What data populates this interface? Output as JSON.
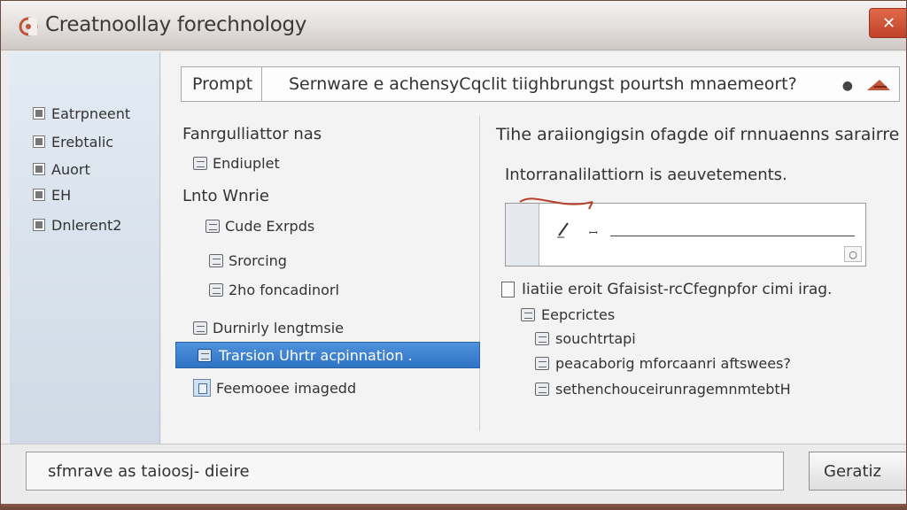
{
  "window": {
    "title": "Creatnoollay forechnology"
  },
  "sidebar": {
    "items": [
      {
        "label": "Eatrpneent"
      },
      {
        "label": "Erebtalic"
      },
      {
        "label": "Auort"
      },
      {
        "label": "EH"
      },
      {
        "label": "Dnlerent2"
      }
    ]
  },
  "prompt": {
    "label": "Prompt",
    "value": "Sernware e achensyCqclit tiighbrungst pourtsh mnaemeort?"
  },
  "left_column": {
    "heading": "Fanrgulliattor nas",
    "input_label": "Endiuplet",
    "section_heading": "Lnto Wnrie",
    "items": [
      {
        "label": "Cude Exrpds"
      },
      {
        "label": "Srorcing"
      },
      {
        "label": "2ho foncadinorl"
      },
      {
        "label": "Durnirly lengtmsie"
      }
    ],
    "selected_item": "Trarsion Uhrtr acpinnation .",
    "last_item": "Feemooee imagedd"
  },
  "right_column": {
    "title": "Tihe araiiongigsin ofagde oif rnnuaenns sarairre",
    "subtitle": "Intorranalilattiorn is aeuvetements.",
    "option_label": "Iiatiie eroit Gfaisist-rcCfegnpfor cimi irag.",
    "sub_items": [
      {
        "label": "Eepcrictes"
      },
      {
        "label": "souchtrtapi"
      },
      {
        "label": "peacaborig mforcaanri aftswees?"
      },
      {
        "label": "sethenchouceirunragemnmtebtH"
      }
    ]
  },
  "footer": {
    "status": "sfmrave as taioosj- dieire",
    "generate_label": "Geratiz"
  },
  "colors": {
    "accent": "#2f73c4",
    "close": "#c1412a",
    "frame": "#6a3e30"
  }
}
